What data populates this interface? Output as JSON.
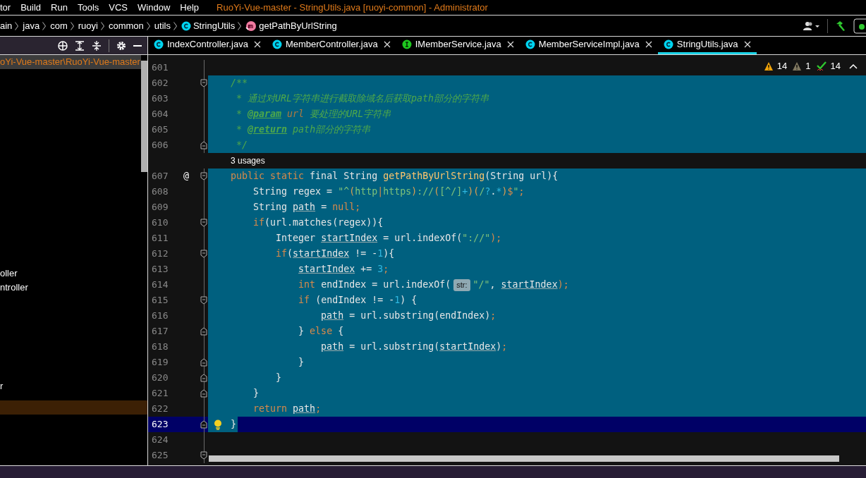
{
  "menu": {
    "items": [
      "tor",
      "Build",
      "Run",
      "Tools",
      "VCS",
      "Window",
      "Help"
    ],
    "title": "RuoYi-Vue-master - StringUtils.java [ruoyi-common] - Administrator"
  },
  "breadcrumbs": [
    {
      "label": "ain",
      "kind": "folder"
    },
    {
      "label": "java",
      "kind": "folder"
    },
    {
      "label": "com",
      "kind": "folder"
    },
    {
      "label": "ruoyi",
      "kind": "folder"
    },
    {
      "label": "common",
      "kind": "folder"
    },
    {
      "label": "utils",
      "kind": "folder"
    },
    {
      "label": "StringUtils",
      "kind": "class"
    },
    {
      "label": "getPathByUrlString",
      "kind": "method"
    }
  ],
  "tabs": [
    {
      "label": "IndexController.java",
      "kind": "class",
      "selected": false
    },
    {
      "label": "MemberController.java",
      "kind": "class",
      "selected": false
    },
    {
      "label": "IMemberService.java",
      "kind": "interface",
      "selected": false
    },
    {
      "label": "MemberServiceImpl.java",
      "kind": "class",
      "selected": false
    },
    {
      "label": "StringUtils.java",
      "kind": "class",
      "selected": true
    }
  ],
  "project_tree": [
    {
      "label": "oYi-Vue-master\\RuoYi-Vue-master",
      "selected": true
    },
    {
      "label": "oller",
      "selected": false
    },
    {
      "label": "ntroller",
      "selected": false
    },
    {
      "label": "r",
      "selected": false
    }
  ],
  "inspections": {
    "warnings": "14",
    "weak_warnings": "1",
    "typos": "14"
  },
  "lines": [
    {
      "kind": "code",
      "number": "601",
      "selected": false
    },
    {
      "kind": "code",
      "number": "602",
      "fold_open": true,
      "selected": true,
      "tokens": [
        {
          "text": "    /**",
          "kind": "doc"
        }
      ]
    },
    {
      "kind": "code",
      "number": "603",
      "selected": true,
      "tokens": [
        {
          "text": "     * 通过对URL字符串进行截取除域名后获取path部分的字符串",
          "kind": "doc"
        }
      ]
    },
    {
      "kind": "code",
      "number": "604",
      "selected": true,
      "tokens": [
        {
          "text": "     * ",
          "kind": "doc"
        },
        {
          "text": "@param",
          "kind": "doctag"
        },
        {
          "text": " url",
          "kind": "docparam"
        },
        {
          "text": " 要处理的URL字符串",
          "kind": "doc"
        }
      ]
    },
    {
      "kind": "code",
      "number": "605",
      "selected": true,
      "tokens": [
        {
          "text": "     * ",
          "kind": "doc"
        },
        {
          "text": "@return",
          "kind": "doctag"
        },
        {
          "text": " path部分的字符串",
          "kind": "doc"
        }
      ]
    },
    {
      "kind": "code",
      "number": "606",
      "fold_close": true,
      "selected": true,
      "tokens": [
        {
          "text": "     */",
          "kind": "doc"
        }
      ]
    },
    {
      "kind": "inlay",
      "text": "3 usages"
    },
    {
      "kind": "code",
      "number": "607",
      "fold_open": true,
      "gutter_mark": "@",
      "selected": true,
      "tokens": [
        {
          "text": "    public static ",
          "kind": "kw"
        },
        {
          "text": "final String ",
          "kind": "plain"
        },
        {
          "text": "getPathByUrlString",
          "kind": "method"
        },
        {
          "text": "(String url){",
          "kind": "plain"
        }
      ]
    },
    {
      "kind": "code",
      "number": "608",
      "selected": true,
      "tokens": [
        {
          "text": "        String regex = ",
          "kind": "plain"
        },
        {
          "text": "\"^",
          "kind": "str"
        },
        {
          "text": "(",
          "kind": "rxgroup"
        },
        {
          "text": "http",
          "kind": "str"
        },
        {
          "text": "|",
          "kind": "kw"
        },
        {
          "text": "https",
          "kind": "str"
        },
        {
          "text": ")",
          "kind": "rxgroup"
        },
        {
          "text": "://",
          "kind": "str"
        },
        {
          "text": "(",
          "kind": "rxgroup"
        },
        {
          "text": "[^/]",
          "kind": "str"
        },
        {
          "text": "+",
          "kind": "num"
        },
        {
          "text": ")(",
          "kind": "rxgroup"
        },
        {
          "text": "/",
          "kind": "str"
        },
        {
          "text": "?",
          "kind": "num"
        },
        {
          "text": ".",
          "kind": "plain"
        },
        {
          "text": "*",
          "kind": "num"
        },
        {
          "text": ")",
          "kind": "rxgroup"
        },
        {
          "text": "$",
          "kind": "kw"
        },
        {
          "text": "\"",
          "kind": "str"
        },
        {
          "text": ";",
          "kind": "kw"
        }
      ]
    },
    {
      "kind": "code",
      "number": "609",
      "selected": true,
      "tokens": [
        {
          "text": "        String ",
          "kind": "plain"
        },
        {
          "text": "path",
          "kind": "var"
        },
        {
          "text": " = ",
          "kind": "plain"
        },
        {
          "text": "null;",
          "kind": "kw"
        }
      ]
    },
    {
      "kind": "code",
      "number": "610",
      "fold_open": true,
      "selected": true,
      "tokens": [
        {
          "text": "        if",
          "kind": "kw"
        },
        {
          "text": "(url.matches(regex)){",
          "kind": "plain"
        }
      ]
    },
    {
      "kind": "code",
      "number": "611",
      "selected": true,
      "tokens": [
        {
          "text": "            Integer ",
          "kind": "plain"
        },
        {
          "text": "startIndex",
          "kind": "var"
        },
        {
          "text": " = url.indexOf(",
          "kind": "plain"
        },
        {
          "text": "\"://\"",
          "kind": "str"
        },
        {
          "text": ");",
          "kind": "kw"
        }
      ]
    },
    {
      "kind": "code",
      "number": "612",
      "fold_open": true,
      "selected": true,
      "tokens": [
        {
          "text": "            if",
          "kind": "kw"
        },
        {
          "text": "(",
          "kind": "plain"
        },
        {
          "text": "startIndex",
          "kind": "var"
        },
        {
          "text": " != -",
          "kind": "plain"
        },
        {
          "text": "1",
          "kind": "num"
        },
        {
          "text": "){",
          "kind": "plain"
        }
      ]
    },
    {
      "kind": "code",
      "number": "613",
      "selected": true,
      "tokens": [
        {
          "text": "                startIndex",
          "kind": "var"
        },
        {
          "text": " += ",
          "kind": "plain"
        },
        {
          "text": "3",
          "kind": "num"
        },
        {
          "text": ";",
          "kind": "kw"
        }
      ]
    },
    {
      "kind": "code",
      "number": "614",
      "selected": true,
      "tokens": [
        {
          "text": "                int ",
          "kind": "kw"
        },
        {
          "text": "endIndex = url.indexOf(",
          "kind": "plain"
        },
        {
          "text": "str:",
          "kind": "hint"
        },
        {
          "text": "\"/\"",
          "kind": "str"
        },
        {
          "text": ", ",
          "kind": "plain"
        },
        {
          "text": "startIndex",
          "kind": "var"
        },
        {
          "text": ");",
          "kind": "kw"
        }
      ]
    },
    {
      "kind": "code",
      "number": "615",
      "fold_open": true,
      "selected": true,
      "tokens": [
        {
          "text": "                if ",
          "kind": "kw"
        },
        {
          "text": "(endIndex != -",
          "kind": "plain"
        },
        {
          "text": "1",
          "kind": "num"
        },
        {
          "text": ") {",
          "kind": "plain"
        }
      ]
    },
    {
      "kind": "code",
      "number": "616",
      "selected": true,
      "tokens": [
        {
          "text": "                    path",
          "kind": "var"
        },
        {
          "text": " = url.substring(endIndex)",
          "kind": "plain"
        },
        {
          "text": ";",
          "kind": "kw"
        }
      ]
    },
    {
      "kind": "code",
      "number": "617",
      "fold_close": true,
      "selected": true,
      "tokens": [
        {
          "text": "                } ",
          "kind": "plain"
        },
        {
          "text": "else ",
          "kind": "kw"
        },
        {
          "text": "{",
          "kind": "plain"
        }
      ]
    },
    {
      "kind": "code",
      "number": "618",
      "selected": true,
      "tokens": [
        {
          "text": "                    path",
          "kind": "var"
        },
        {
          "text": " = url.substring(",
          "kind": "plain"
        },
        {
          "text": "startIndex",
          "kind": "var"
        },
        {
          "text": ")",
          "kind": "plain"
        },
        {
          "text": ";",
          "kind": "kw"
        }
      ]
    },
    {
      "kind": "code",
      "number": "619",
      "fold_close": true,
      "selected": true,
      "tokens": [
        {
          "text": "                }",
          "kind": "plain"
        }
      ]
    },
    {
      "kind": "code",
      "number": "620",
      "fold_close": true,
      "selected": true,
      "tokens": [
        {
          "text": "            }",
          "kind": "plain"
        }
      ]
    },
    {
      "kind": "code",
      "number": "621",
      "fold_close": true,
      "selected": true,
      "tokens": [
        {
          "text": "        }",
          "kind": "plain"
        }
      ]
    },
    {
      "kind": "code",
      "number": "622",
      "selected": true,
      "tokens": [
        {
          "text": "        return ",
          "kind": "kw"
        },
        {
          "text": "path",
          "kind": "var"
        },
        {
          "text": ";",
          "kind": "kw"
        }
      ]
    },
    {
      "kind": "code",
      "number": "623",
      "fold_close": true,
      "intention": true,
      "current": true,
      "selected": true,
      "tokens": [
        {
          "text": "    }",
          "kind": "plain"
        }
      ]
    },
    {
      "kind": "code",
      "number": "624",
      "selected": false
    },
    {
      "kind": "code",
      "number": "625",
      "fold_open": true,
      "selected": false
    }
  ]
}
